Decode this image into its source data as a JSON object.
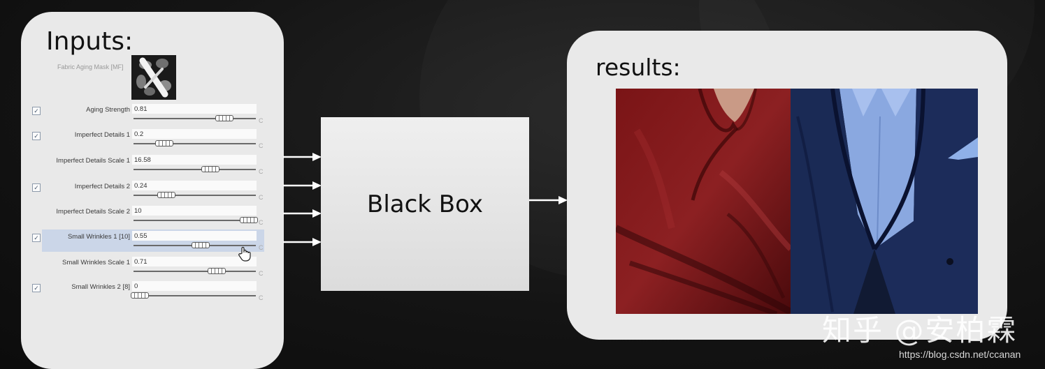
{
  "inputs": {
    "title": "Inputs:",
    "mask_label": "Fabric Aging Mask [MF]",
    "params": [
      {
        "label": "Aging Strength",
        "value": "0.81",
        "checked": true,
        "knob": 0.74
      },
      {
        "label": "Imperfect Details 1",
        "value": "0.2",
        "checked": true,
        "knob": 0.25
      },
      {
        "label": "Imperfect Details Scale 1",
        "value": "16.58",
        "checked": false,
        "knob": 0.63
      },
      {
        "label": "Imperfect Details 2",
        "value": "0.24",
        "checked": true,
        "knob": 0.27
      },
      {
        "label": "Imperfect Details Scale 2",
        "value": "10",
        "checked": false,
        "knob": 0.94
      },
      {
        "label": "Small Wrinkles 1 [10]",
        "value": "0.55",
        "checked": true,
        "knob": 0.55,
        "highlight": true
      },
      {
        "label": "Small Wrinkles Scale 1",
        "value": "0.71",
        "checked": false,
        "knob": 0.68
      },
      {
        "label": "Small Wrinkles 2 [8]",
        "value": "0",
        "checked": true,
        "knob": 0.05
      }
    ],
    "check_glyph": "✓",
    "reset_glyph": "C"
  },
  "black_box": {
    "label": "Black Box"
  },
  "results": {
    "title": "results:"
  },
  "watermark": "知乎 @安柏霖",
  "url": "https://blog.csdn.net/ccanan"
}
